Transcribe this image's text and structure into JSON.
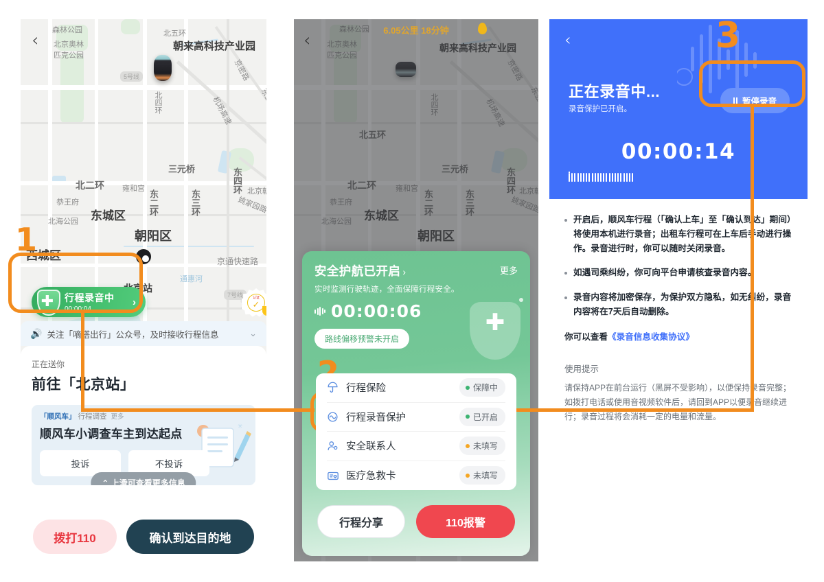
{
  "panel1": {
    "back_icon": "chevron-left-icon",
    "map": {
      "title_label": "朝来高科技产业园",
      "labels": [
        "森林公园",
        "北京奥林",
        "匹克公园",
        "北五环",
        "京密路",
        "东五环",
        "北四环",
        "机场高速",
        "三元桥",
        "北二环",
        "雍和宫",
        "东二环",
        "东三环",
        "东四环",
        "北京朝阳站",
        "姚家园路",
        "恭王府",
        "北海公园",
        "东城区",
        "朝阳区",
        "西城区",
        "北京站",
        "通惠河",
        "京通快速路"
      ],
      "metro_pills": [
        "5号线",
        "7号线"
      ],
      "destination_label": "北京站"
    },
    "recording_pill": {
      "title": "行程录音中",
      "time": "00:00:04",
      "arrow": "›",
      "shield_icon": "shield-plus-icon"
    },
    "notice": {
      "speaker_icon": "speaker-icon",
      "text": "关注「嘀嗒出行」公众号，及时接收行程信息",
      "chevron_icon": "chevron-down-icon"
    },
    "trip": {
      "small_label": "正在送你",
      "big_label": "前往「北京站」"
    },
    "survey": {
      "tag": "「顺风车」",
      "tag_suffix": "行程调查",
      "more": "更多",
      "question": "顺风车小调查车主到达起点",
      "options": [
        "投诉",
        "不投诉"
      ],
      "swipe_tip": "上滑可查看更多信息",
      "swipe_icon": "chevron-up-icon"
    },
    "actions": {
      "call_110": "拨打110",
      "confirm": "确认到达目的地"
    }
  },
  "panel2": {
    "back_icon": "chevron-left-icon",
    "route": {
      "distance": "6.05公里",
      "duration": "18分钟",
      "title_label": "朝来高科技产业园",
      "pin_icon": "map-pin-icon"
    },
    "green_card": {
      "title": "安全护航已开启",
      "chevron": "›",
      "more": "更多",
      "subtitle": "实时监测行驶轨迹，全面保障行程安全。",
      "timer": "00:00:06",
      "chip": "路线偏移预警未开启",
      "shield_icon": "shield-plus-icon"
    },
    "list": [
      {
        "icon": "umbrella-icon",
        "label": "行程保险",
        "status": "保障中",
        "dot": "#3cb371"
      },
      {
        "icon": "recording-icon",
        "label": "行程录音保护",
        "status": "已开启",
        "dot": "#3cb371"
      },
      {
        "icon": "contact-icon",
        "label": "安全联系人",
        "status": "未填写",
        "dot": "#f5a623"
      },
      {
        "icon": "medical-card-icon",
        "label": "医疗急救卡",
        "status": "未填写",
        "dot": "#f5a623"
      }
    ],
    "actions": {
      "share": "行程分享",
      "alarm": "110报警"
    }
  },
  "panel3": {
    "back_icon": "chevron-left-icon",
    "title": "正在录音中...",
    "subtitle": "录音保护已开启。",
    "pause_button": {
      "label": "暂停录音",
      "icon": "pause-icon"
    },
    "timer": "00:00:14",
    "bullets": [
      "开启后，顺风车行程（「确认上车」至「确认到达」期间）将使用本机进行录音；出租车行程可在上车后手动进行操作。录音进行时，你可以随时关闭录音。",
      "如遇司乘纠纷，你可向平台申请核查录音内容。",
      "录音内容将加密保存，为保护双方隐私，如无纠纷，录音内容将在7天后自动删除。"
    ],
    "agreement_prefix": "你可以查看",
    "agreement_link": "《录音信息收集协议》",
    "tips_title": "使用提示",
    "tips_body": "请保持APP在前台运行（黑屏不受影响），以便保持录音完整；如拨打电话或使用音视频软件后，请回到APP以便录音继续进行；录音过程将会消耗一定的电量和流量。"
  },
  "annotations": {
    "accent_color": "#f28c1e",
    "steps": [
      "1",
      "2",
      "3"
    ]
  }
}
